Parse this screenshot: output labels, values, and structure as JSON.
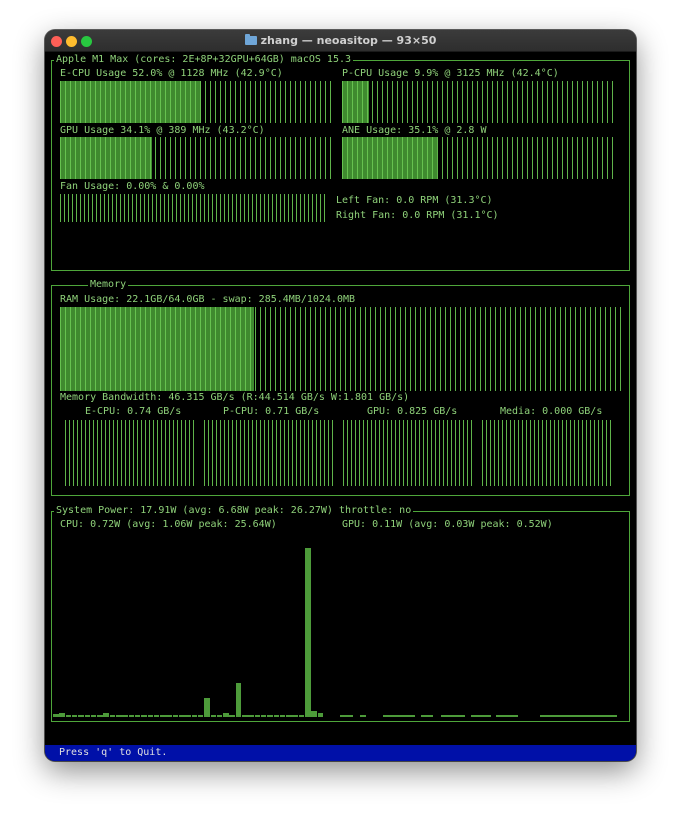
{
  "window": {
    "title": "zhang — neoasitop — 93×50"
  },
  "processor": {
    "header": "Apple M1 Max (cores: 2E+8P+32GPU+64GB) macOS 15.3",
    "ecpu": {
      "label": "E-CPU Usage 52.0% @ 1128 MHz (42.9°C)",
      "usage": 0.52
    },
    "pcpu": {
      "label": "P-CPU Usage 9.9% @ 3125 MHz (42.4°C)",
      "usage": 0.099
    },
    "gpu": {
      "label": "GPU Usage 34.1% @ 389 MHz (43.2°C)",
      "usage": 0.341
    },
    "ane": {
      "label": "ANE Usage: 35.1% @ 2.8 W",
      "usage": 0.351
    },
    "fan": {
      "label": "Fan Usage: 0.00% & 0.00%",
      "left": "Left Fan: 0.0 RPM (31.3°C)",
      "right": "Right Fan: 0.0 RPM (31.1°C)"
    }
  },
  "memory": {
    "title": "Memory",
    "ram_label": "RAM Usage: 22.1GB/64.0GB - swap: 285.4MB/1024.0MB",
    "ram_usage": 0.345,
    "bandwidth_label": "Memory Bandwidth: 46.315 GB/s (R:44.514 GB/s W:1.801 GB/s)",
    "ecpu_bw": "E-CPU: 0.74 GB/s",
    "pcpu_bw": "P-CPU: 0.71 GB/s",
    "gpu_bw": "GPU: 0.825 GB/s",
    "media_bw": "Media: 0.000 GB/s"
  },
  "power": {
    "header": "System Power: 17.91W (avg: 6.68W peak: 26.27W) throttle: no",
    "cpu_label": "CPU: 0.72W (avg: 1.06W peak: 25.64W)",
    "gpu_label": "GPU: 0.11W (avg: 0.03W peak: 0.52W)",
    "history_watts": [
      0.4,
      0.6,
      0.3,
      0.3,
      0.3,
      0.3,
      0.3,
      0.3,
      0.5,
      0.3,
      0.3,
      0.3,
      0.3,
      0.3,
      0.3,
      0.3,
      0.3,
      0.3,
      0.3,
      0.3,
      0.3,
      0.3,
      0.3,
      0.3,
      2.7,
      0.3,
      0.3,
      0.6,
      0.3,
      4.8,
      0.3,
      0.3,
      0.3,
      0.3,
      0.3,
      0.3,
      0.3,
      0.3,
      0.3,
      0.3,
      23.8,
      0.8,
      0.6
    ]
  },
  "footer": {
    "hint": "Press 'q' to Quit."
  },
  "colors": {
    "accent": "#4d9b3a",
    "text": "#8fd27a",
    "status_bar": "#0010a8"
  }
}
